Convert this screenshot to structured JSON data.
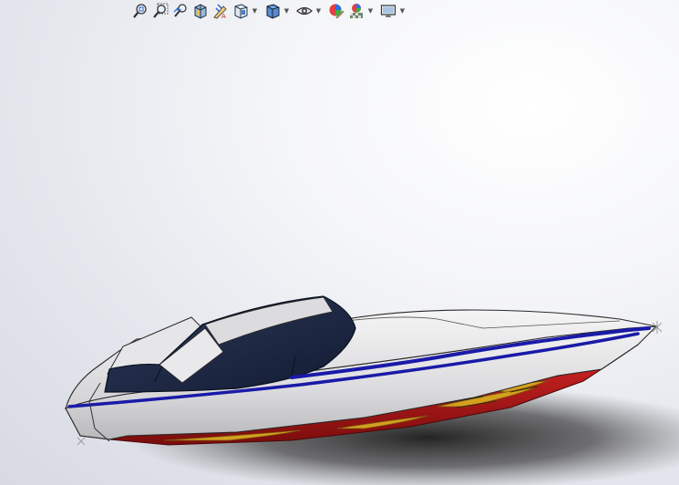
{
  "toolbar": {
    "buttons": [
      {
        "icon": "zoom-to-fit-icon",
        "dropdown": false
      },
      {
        "icon": "zoom-to-area-icon",
        "dropdown": false
      },
      {
        "icon": "previous-view-icon",
        "dropdown": false
      },
      {
        "icon": "section-view-icon",
        "dropdown": false
      },
      {
        "icon": "dynamic-annotation-views-icon",
        "dropdown": false
      },
      {
        "icon": "view-orientation-icon",
        "dropdown": true
      },
      {
        "icon": "display-style-icon",
        "dropdown": true
      },
      {
        "icon": "hide-show-items-icon",
        "dropdown": true
      },
      {
        "icon": "edit-appearance-icon",
        "dropdown": false
      },
      {
        "icon": "apply-scene-icon",
        "dropdown": true
      },
      {
        "icon": "view-settings-icon",
        "dropdown": true
      }
    ]
  },
  "model": {
    "name": "speedboat",
    "colors": {
      "hull": "#e4e4e6",
      "stripe": "#1a1aa8",
      "cockpit": "#1c2742",
      "bottom": "#b01818",
      "flame": "#d4a020"
    }
  }
}
